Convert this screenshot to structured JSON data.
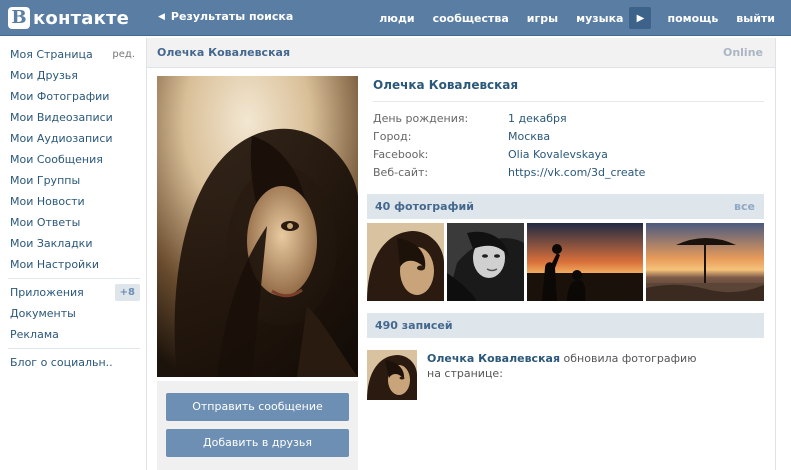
{
  "header": {
    "logo_letter": "В",
    "logo_text": "контакте",
    "back_label": "Результаты поиска",
    "nav": [
      "люди",
      "сообщества",
      "игры",
      "музыка"
    ],
    "nav_right": [
      "помощь",
      "выйти"
    ]
  },
  "sidebar": {
    "items": [
      {
        "label": "Моя Страница"
      },
      {
        "label": "Мои Друзья"
      },
      {
        "label": "Мои Фотографии"
      },
      {
        "label": "Мои Видеозаписи"
      },
      {
        "label": "Мои Аудиозаписи"
      },
      {
        "label": "Мои Сообщения"
      },
      {
        "label": "Мои Группы"
      },
      {
        "label": "Мои Новости"
      },
      {
        "label": "Мои Ответы"
      },
      {
        "label": "Мои Закладки"
      },
      {
        "label": "Мои Настройки"
      }
    ],
    "edit_label": "ред.",
    "apps": {
      "label": "Приложения",
      "badge": "+8"
    },
    "docs_label": "Документы",
    "ads_label": "Реклама",
    "blog_label": "Блог о социальн.."
  },
  "page": {
    "title": "Олечка Ковалевская",
    "status": "Online"
  },
  "profile": {
    "name": "Олечка Ковалевская",
    "info": [
      {
        "label": "День рождения:",
        "value": "1 декабря"
      },
      {
        "label": "Город:",
        "value": "Москва"
      },
      {
        "label": "Facebook:",
        "value": "Olia Kovalevskaya"
      },
      {
        "label": "Веб-сайт:",
        "value": "https://vk.com/3d_create"
      }
    ],
    "send_message": "Отправить сообщение",
    "add_friend": "Добавить в друзья"
  },
  "photos": {
    "title": "40 фотографий",
    "all_label": "все"
  },
  "wall": {
    "title": "490 записей",
    "post_author": "Олечка Ковалевская",
    "post_action": "обновила фотографию на странице:"
  },
  "colors": {
    "topbar": "#597da3",
    "link": "#2b587a",
    "section": "#dee5eb",
    "button": "#6d8fb3"
  }
}
